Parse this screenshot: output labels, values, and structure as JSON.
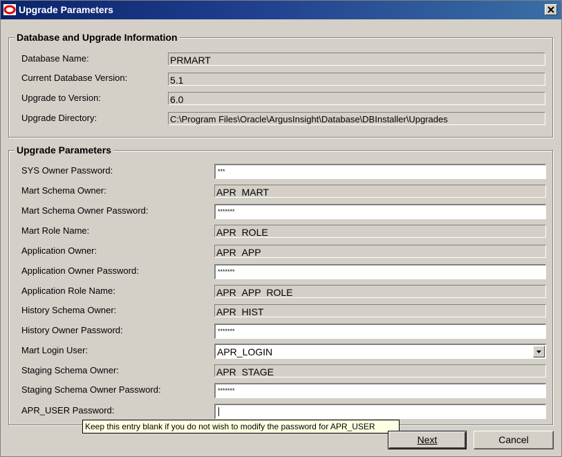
{
  "window": {
    "title": "Upgrade Parameters",
    "close_icon": "close-icon"
  },
  "db_info": {
    "legend": "Database and Upgrade Information",
    "rows": [
      {
        "label": "Database Name:",
        "value": "PRMART"
      },
      {
        "label": "Current Database Version:",
        "value": "5.1"
      },
      {
        "label": "Upgrade to Version:",
        "value": "6.0"
      },
      {
        "label": "Upgrade Directory:",
        "value": "C:\\Program Files\\Oracle\\ArgusInsight\\Database\\DBInstaller\\Upgrades"
      }
    ]
  },
  "params": {
    "legend": "Upgrade Parameters",
    "rows": [
      {
        "label": "SYS Owner Password:",
        "value": "***"
      },
      {
        "label": "Mart Schema Owner:",
        "value": "APR_MART"
      },
      {
        "label": "Mart Schema Owner Password:",
        "value": "*******"
      },
      {
        "label": "Mart Role Name:",
        "value": "APR_ROLE"
      },
      {
        "label": "Application Owner:",
        "value": "APR_APP"
      },
      {
        "label": "Application Owner Password:",
        "value": "*******"
      },
      {
        "label": "Application Role Name:",
        "value": "APR_APP_ROLE"
      },
      {
        "label": "History Schema Owner:",
        "value": "APR_HIST"
      },
      {
        "label": "History Owner Password:",
        "value": "*******"
      },
      {
        "label": "Mart Login User:",
        "value": "APR_LOGIN"
      },
      {
        "label": "Staging Schema Owner:",
        "value": "APR_STAGE"
      },
      {
        "label": "Staging Schema Owner Password:",
        "value": "*******"
      },
      {
        "label": "APR_USER Password:",
        "value": ""
      }
    ]
  },
  "tooltip": "Keep this entry blank if you do not wish to modify the password for APR_USER",
  "buttons": {
    "next": "Next",
    "cancel": "Cancel"
  }
}
